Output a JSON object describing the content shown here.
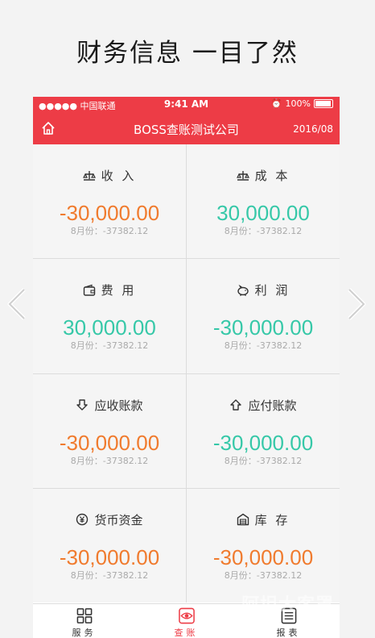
{
  "promo": {
    "title": "财务信息 一目了然"
  },
  "status_bar": {
    "carrier": "●●●●● 中国联通",
    "time": "9:41 AM",
    "battery": "100%"
  },
  "nav": {
    "title": "BOSS查账测试公司",
    "date": "2016/08"
  },
  "cards": [
    {
      "label": "收 入",
      "icon": "scale-icon",
      "value": "-30,000.00",
      "sub": "8月份：-37382.12",
      "tone": "neg"
    },
    {
      "label": "成 本",
      "icon": "scale-icon",
      "value": "30,000.00",
      "sub": "8月份：-37382.12",
      "tone": "pos"
    },
    {
      "label": "费 用",
      "icon": "wallet-icon",
      "value": "30,000.00",
      "sub": "8月份：-37382.12",
      "tone": "pos"
    },
    {
      "label": "利 润",
      "icon": "piggy-bank-icon",
      "value": "-30,000.00",
      "sub": "8月份：-37382.12",
      "tone": "neg"
    },
    {
      "label": "应收账款",
      "icon": "arrow-down-icon",
      "value": "-30,000.00",
      "sub": "8月份：-37382.12",
      "tone": "neg"
    },
    {
      "label": "应付账款",
      "icon": "arrow-up-icon",
      "value": "-30,000.00",
      "sub": "8月份：-37382.12",
      "tone": "pos"
    },
    {
      "label": "货币资金",
      "icon": "yen-coin-icon",
      "value": "-30,000.00",
      "sub": "8月份：-37382.12",
      "tone": "neg"
    },
    {
      "label": "库 存",
      "icon": "warehouse-icon",
      "value": "-30,000.00",
      "sub": "8月份：-37382.12",
      "tone": "neg"
    }
  ],
  "tabs": [
    {
      "label": "服务",
      "icon": "grid-icon",
      "active": false
    },
    {
      "label": "查账",
      "icon": "eye-icon",
      "active": true
    },
    {
      "label": "报表",
      "icon": "list-icon",
      "active": false
    }
  ],
  "watermark": "阿坦大客罩",
  "colors": {
    "header": "#ed3c46",
    "negative": "#f07b2e",
    "positive": "#36c8a8"
  }
}
